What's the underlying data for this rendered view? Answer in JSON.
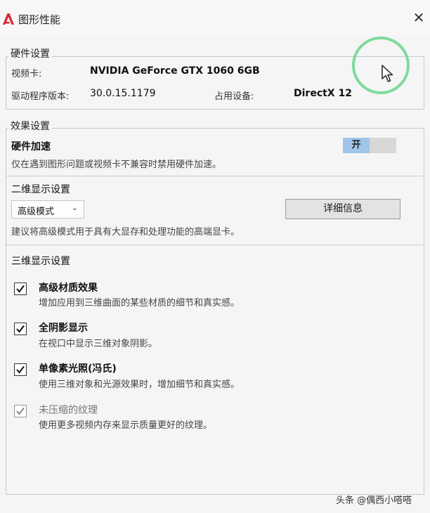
{
  "window": {
    "title": "图形性能",
    "close_glyph": "✕"
  },
  "hardware": {
    "legend": "硬件设置",
    "gpu_label": "视频卡:",
    "gpu_value": "NVIDIA GeForce GTX 1060 6GB",
    "driver_label": "驱动程序版本:",
    "driver_value": "30.0.15.1179",
    "device_label": "占用设备:",
    "device_value": "DirectX 12"
  },
  "effects": {
    "legend": "效果设置",
    "hw_accel_title": "硬件加速",
    "hw_accel_toggle": "开",
    "hw_accel_desc": "仅在遇到图形问题或视频卡不兼容时禁用硬件加速。",
    "display2d": {
      "title": "二维显示设置",
      "mode_selected": "高级模式",
      "details_button": "详细信息",
      "desc": "建议将高级模式用于具有大显存和处理功能的高端显卡。"
    },
    "display3d": {
      "title": "三维显示设置",
      "items": [
        {
          "title": "高级材质效果",
          "desc": "增加应用到三维曲面的某些材质的细节和真实感。",
          "checked": true,
          "enabled": true
        },
        {
          "title": "全阴影显示",
          "desc": "在视口中显示三维对象阴影。",
          "checked": true,
          "enabled": true
        },
        {
          "title": "单像素光照(冯氏)",
          "desc": "使用三维对象和光源效果时，增加细节和真实感。",
          "checked": true,
          "enabled": true
        },
        {
          "title": "未压缩的纹理",
          "desc": "使用更多视频内存来显示质量更好的纹理。",
          "checked": true,
          "enabled": false
        }
      ]
    }
  },
  "watermark": "头条 @偶西小嗒嗒",
  "colors": {
    "toggle_on": "#9fc6ea",
    "app_icon": "#d8262e",
    "cursor_ring": "#6ad58c"
  }
}
